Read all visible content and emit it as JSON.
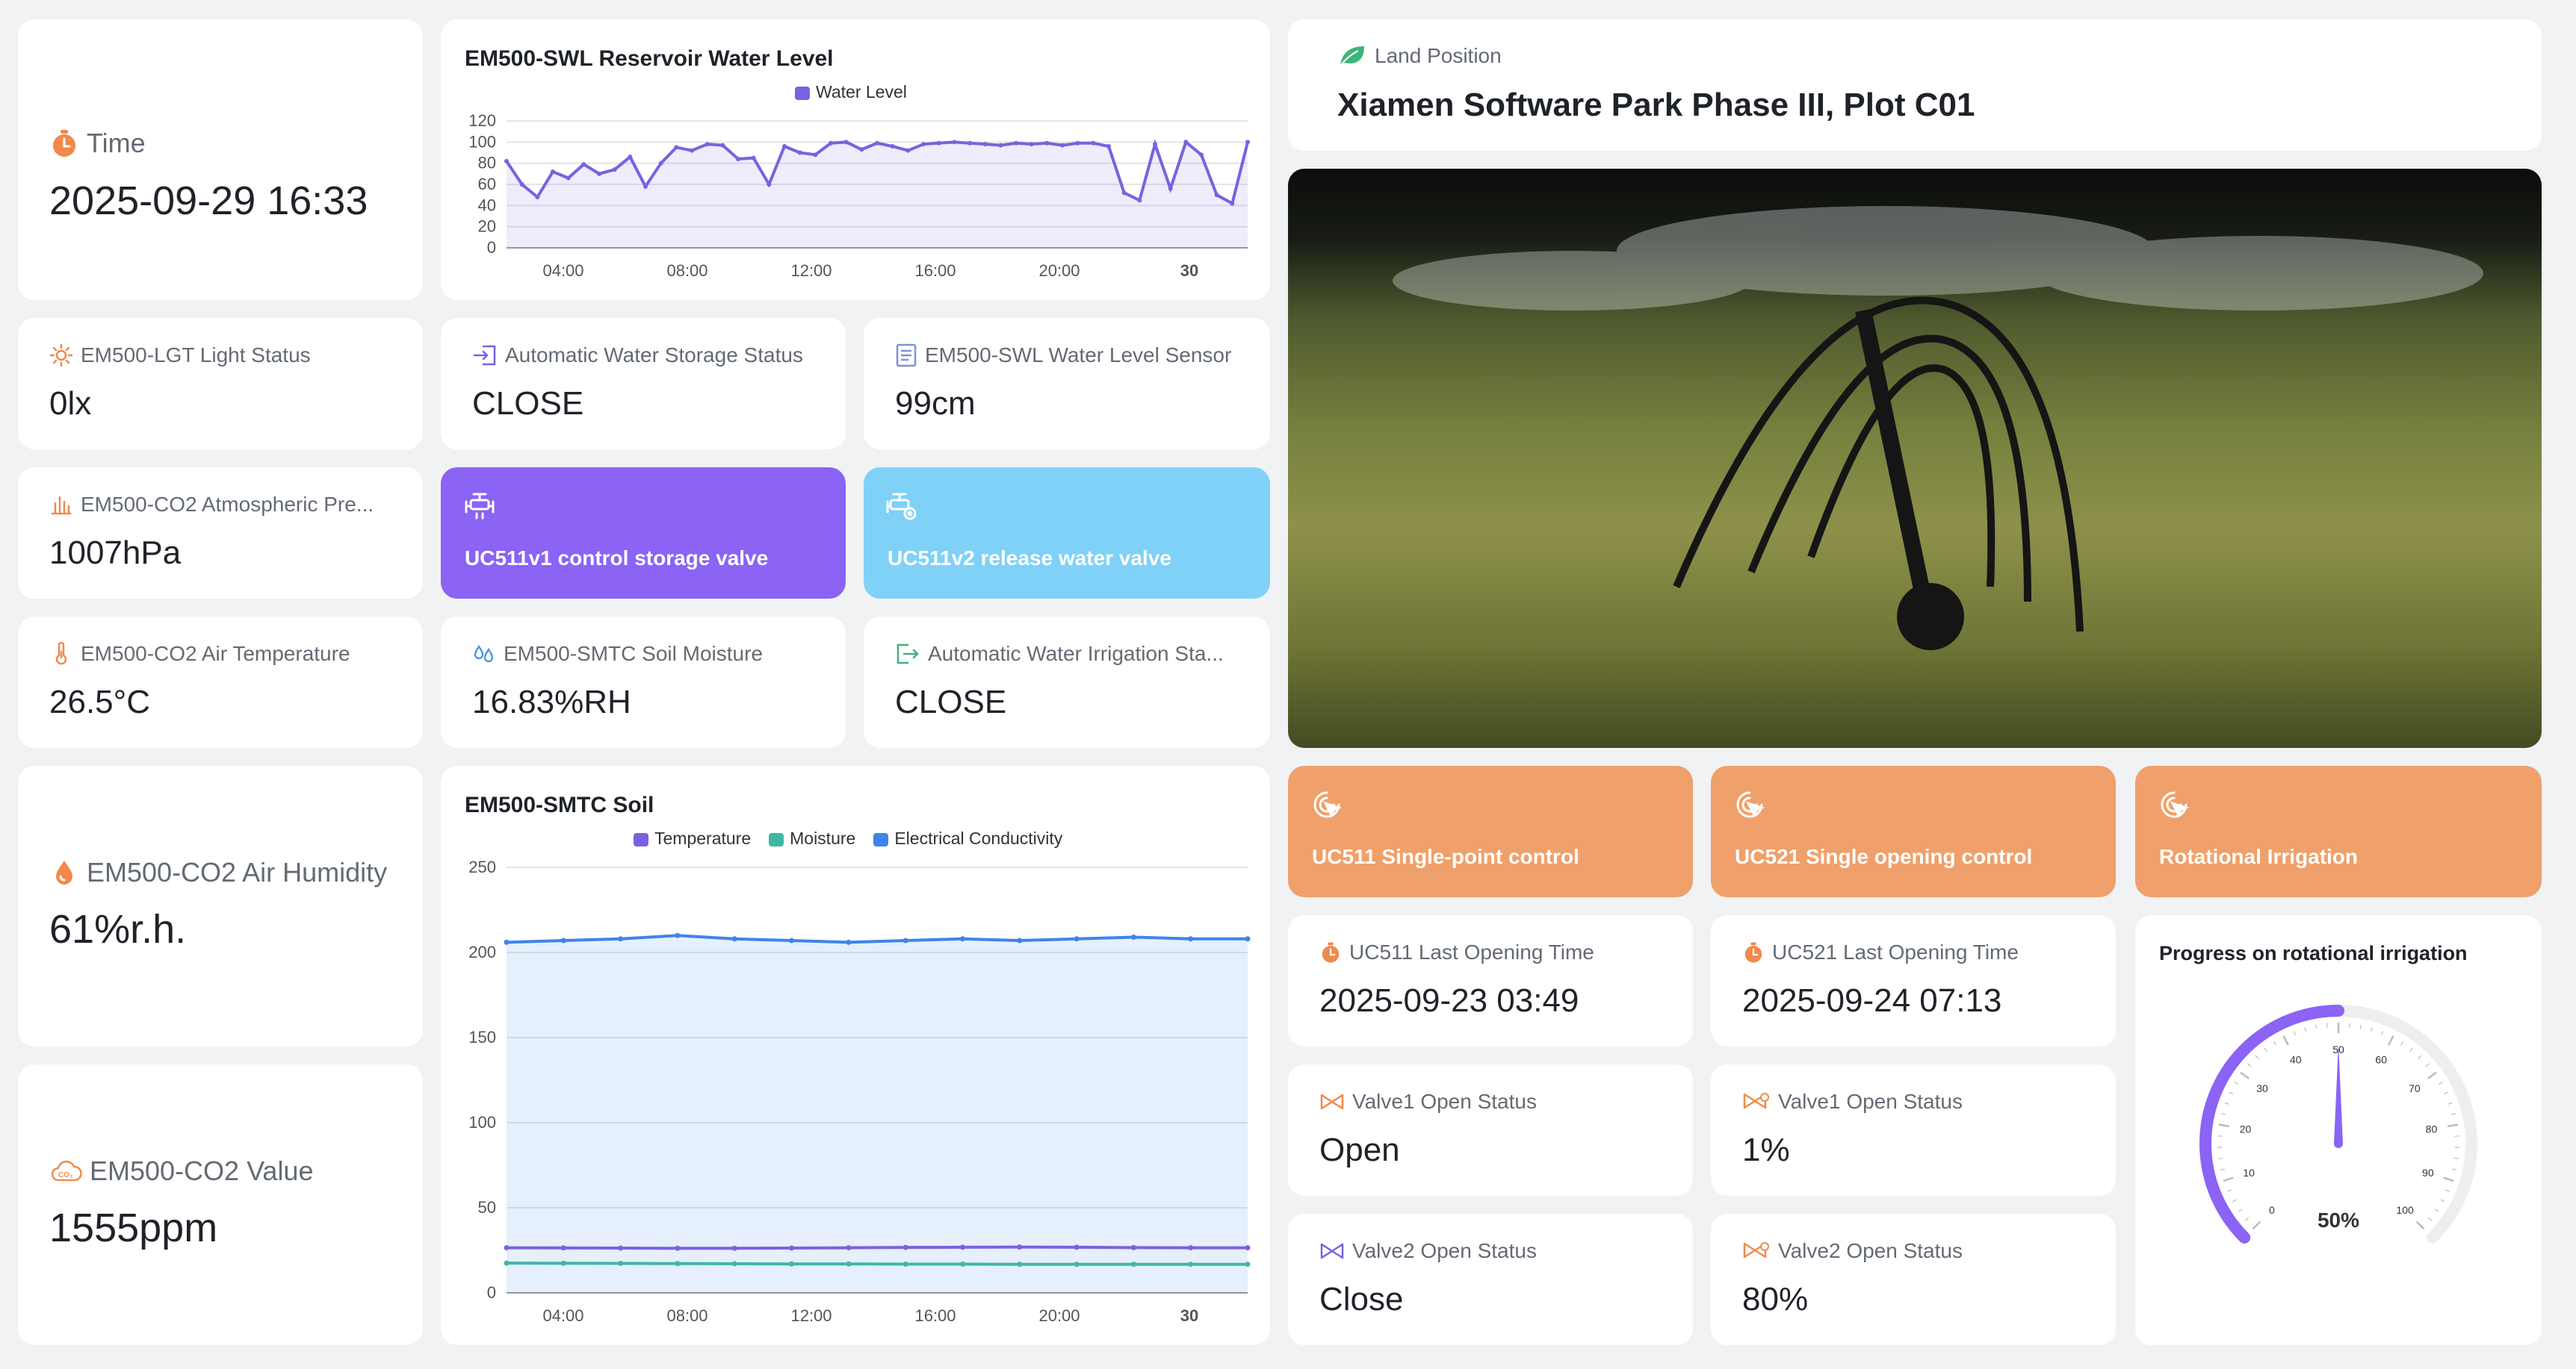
{
  "time": {
    "label": "Time",
    "value": "2025-09-29 16:33"
  },
  "light": {
    "label": "EM500-LGT Light Status",
    "value": "0lx"
  },
  "pressure": {
    "label": "EM500-CO2 Atmospheric Pre...",
    "value": "1007hPa"
  },
  "air_temp": {
    "label": "EM500-CO2 Air Temperature",
    "value": "26.5°C"
  },
  "humidity": {
    "label": "EM500-CO2 Air Humidity",
    "value": "61%r.h."
  },
  "co2": {
    "label": "EM500-CO2 Value",
    "value": "1555ppm"
  },
  "storage_status": {
    "label": "Automatic Water Storage Status",
    "value": "CLOSE"
  },
  "water_level_sensor": {
    "label": "EM500-SWL Water Level Sensor",
    "value": "99cm"
  },
  "storage_valve_button": {
    "label": "UC511v1 control storage valve",
    "color": "#8b63f5"
  },
  "release_valve_button": {
    "label": "UC511v2 release water valve",
    "color": "#7fd1f7"
  },
  "soil_moisture": {
    "label": "EM500-SMTC Soil Moisture",
    "value": "16.83%RH"
  },
  "irrigation_status": {
    "label": "Automatic Water Irrigation Sta...",
    "value": "CLOSE"
  },
  "land": {
    "label": "Land Position",
    "value": "Xiamen Software Park Phase III, Plot C01"
  },
  "control_buttons": [
    {
      "label": "UC511 Single-point control",
      "icon": "pointer-click-icon"
    },
    {
      "label": "UC521 Single opening control",
      "icon": "pointer-click-icon"
    },
    {
      "label": "Rotational Irrigation",
      "icon": "pointer-click-icon"
    }
  ],
  "accent_orange": "#f0a06a",
  "uc511_last": {
    "label": "UC511 Last Opening Time",
    "value": "2025-09-23 03:49"
  },
  "uc521_last": {
    "label": "UC521 Last Opening Time",
    "value": "2025-09-24 07:13"
  },
  "valve_a1": {
    "label": "Valve1 Open Status",
    "value": "Open"
  },
  "valve_a2": {
    "label": "Valve2 Open Status",
    "value": "Close"
  },
  "valve_b1": {
    "label": "Valve1 Open Status",
    "value": "1%"
  },
  "valve_b2": {
    "label": "Valve2 Open Status",
    "value": "80%"
  },
  "gauge": {
    "title": "Progress on rotational irrigation",
    "value": 50,
    "value_text": "50%",
    "min": 0,
    "max": 100,
    "ticks": [
      "0",
      "10",
      "20",
      "30",
      "40",
      "50",
      "60",
      "70",
      "80",
      "90",
      "100"
    ]
  },
  "chart_data": [
    {
      "type": "line",
      "title": "EM500-SWL Reservoir Water Level",
      "legend": [
        "Water Level"
      ],
      "x_ticks": [
        "04:00",
        "08:00",
        "12:00",
        "16:00",
        "20:00",
        "30"
      ],
      "ylim": [
        0,
        120
      ],
      "y_ticks": [
        "0",
        "20",
        "40",
        "60",
        "80",
        "100",
        "120"
      ],
      "series": [
        {
          "name": "Water Level",
          "color": "#7b61e0",
          "x": [
            0,
            0.5,
            1,
            1.5,
            2,
            2.5,
            3,
            3.5,
            4,
            4.5,
            5,
            5.5,
            6,
            6.5,
            7,
            7.5,
            8,
            8.5,
            9,
            9.5,
            10,
            10.5,
            11,
            11.5,
            12,
            12.5,
            13,
            13.5,
            14,
            14.5,
            15,
            15.5,
            16,
            16.5,
            17,
            17.5,
            18,
            18.5,
            19,
            19.5,
            20,
            20.5,
            21,
            21.5,
            22,
            22.5,
            23,
            23.5,
            24
          ],
          "values": [
            82,
            60,
            48,
            72,
            66,
            79,
            70,
            74,
            86,
            58,
            80,
            95,
            92,
            98,
            97,
            84,
            85,
            60,
            96,
            90,
            88,
            99,
            100,
            93,
            99,
            96,
            92,
            98,
            99,
            100,
            99,
            98,
            97,
            99,
            98,
            99,
            97,
            99,
            99,
            96,
            52,
            45,
            98,
            56,
            100,
            88,
            50,
            42,
            100
          ]
        }
      ]
    },
    {
      "type": "area",
      "title": "EM500-SMTC Soil",
      "legend": [
        "Temperature",
        "Moisture",
        "Electrical Conductivity"
      ],
      "x_ticks": [
        "04:00",
        "08:00",
        "12:00",
        "16:00",
        "20:00",
        "30"
      ],
      "ylim": [
        0,
        250
      ],
      "y_ticks": [
        "0",
        "50",
        "100",
        "150",
        "200",
        "250"
      ],
      "series": [
        {
          "name": "Temperature",
          "color": "#7b61e0",
          "values": [
            26.5,
            26.4,
            26.3,
            26.2,
            26.2,
            26.3,
            26.5,
            26.7,
            26.8,
            26.9,
            26.8,
            26.6,
            26.5,
            26.5
          ]
        },
        {
          "name": "Moisture",
          "color": "#3fb7a4",
          "values": [
            17.5,
            17.4,
            17.3,
            17.2,
            17.1,
            17.0,
            17.0,
            16.9,
            16.9,
            16.8,
            16.8,
            16.8,
            16.8,
            16.8
          ]
        },
        {
          "name": "Electrical Conductivity",
          "color": "#3f84ea",
          "values": [
            206,
            207,
            208,
            210,
            208,
            207,
            206,
            207,
            208,
            207,
            208,
            209,
            208,
            208
          ]
        }
      ]
    }
  ]
}
